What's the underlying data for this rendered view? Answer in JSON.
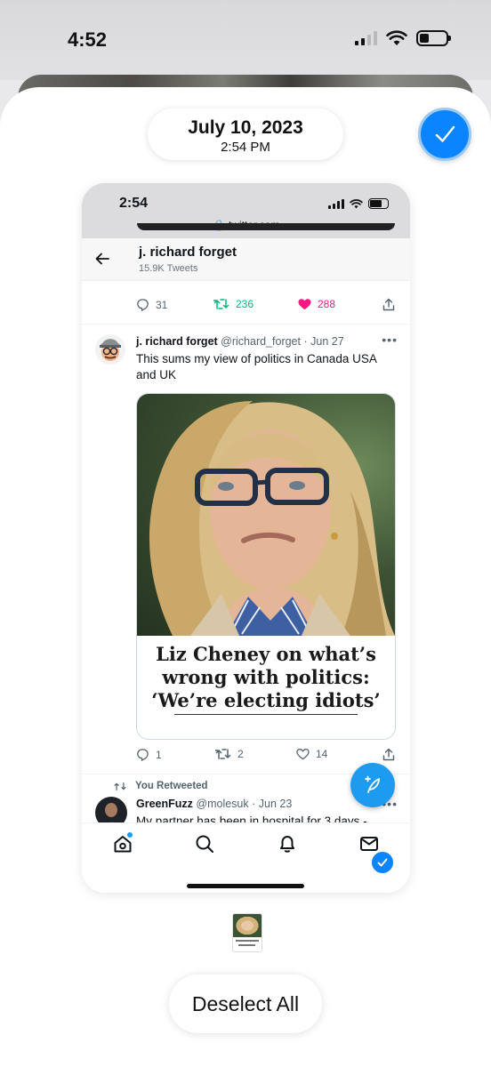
{
  "status_bar": {
    "time": "4:52",
    "battery_level": 0.35
  },
  "header": {
    "date": "July 10, 2023",
    "time": "2:54 PM"
  },
  "screenshot": {
    "status_time": "2:54",
    "url": "🔒 twitter.com",
    "profile": {
      "name": "j. richard forget",
      "tweet_count": "15.9K Tweets"
    },
    "prev_tweet_actions": {
      "replies": "31",
      "retweets": "236",
      "likes": "288"
    },
    "tweet": {
      "name": "j. richard forget",
      "handle": "@richard_forget",
      "date": "· Jun 27",
      "text": "This sums my view of politics in Canada USA and UK",
      "headline": [
        "Liz Cheney on what’s",
        "wrong with politics:",
        "‘We’re electing idiots’"
      ],
      "replies": "1",
      "retweets": "2",
      "likes": "14"
    },
    "retweet_label": "You Retweeted",
    "next_tweet": {
      "name": "GreenFuzz",
      "handle": "@molesuk",
      "date": "· Jun 23",
      "text": "My partner has been in hospital for 3 days -"
    }
  },
  "colors": {
    "accent": "#0a84ff",
    "twitter_blue": "#1d9bf0",
    "retweet_green": "#00ba7c",
    "like_pink": "#f91880"
  },
  "footer": {
    "deselect_label": "Deselect All"
  }
}
